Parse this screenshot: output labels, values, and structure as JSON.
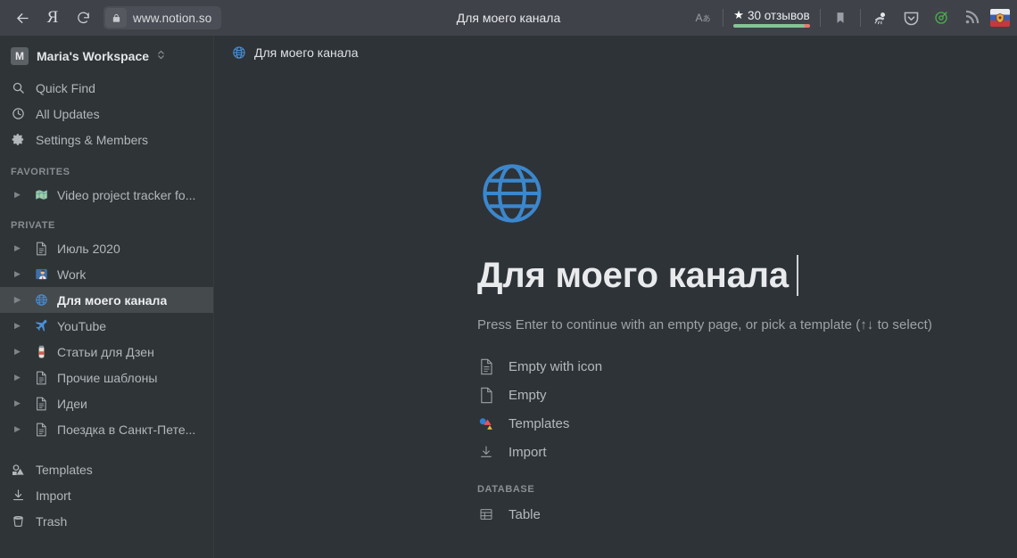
{
  "browser": {
    "back_label": "Back",
    "yandex_label": "Я",
    "reload_label": "Reload",
    "url": "www.notion.so",
    "lock_icon": "lock-icon",
    "window_title": "Для моего канала",
    "toolbar": {
      "translate_label": "A",
      "translate_sub": "あ",
      "reviews_star": "★",
      "reviews_text": "30 отзывов",
      "reviews_fill_color": "#86c496",
      "reviews_track_color": "#e8796f",
      "bookmark_icon": "bookmark-icon",
      "adblock_icon": "adblock-icon",
      "pocket_icon": "pocket-icon",
      "green_shield_icon": "green-circle-icon",
      "rss_icon": "rss-icon",
      "flag_icon": "russia-emblem-icon"
    }
  },
  "sidebar": {
    "workspace": {
      "avatar_letter": "M",
      "name": "Maria's Workspace",
      "caret": "⌃⌄"
    },
    "nav": [
      {
        "label": "Quick Find",
        "icon": "search-icon"
      },
      {
        "label": "All Updates",
        "icon": "clock-icon"
      },
      {
        "label": "Settings & Members",
        "icon": "gear-icon"
      }
    ],
    "favorites_label": "FAVORITES",
    "favorites": [
      {
        "label": "Video project tracker fo...",
        "emoji": "🗺",
        "selected": false
      }
    ],
    "private_label": "PRIVATE",
    "private": [
      {
        "label": "Июль 2020",
        "emoji": "doc",
        "selected": false
      },
      {
        "label": "Work",
        "emoji": "👨‍💼",
        "selected": false
      },
      {
        "label": "Для моего канала",
        "emoji": "globe",
        "selected": true
      },
      {
        "label": "YouTube",
        "emoji": "✈",
        "selected": false
      },
      {
        "label": "Статьи для Дзен",
        "emoji": "🏺",
        "selected": false
      },
      {
        "label": "Прочие шаблоны",
        "emoji": "doc",
        "selected": false
      },
      {
        "label": "Идеи",
        "emoji": "doc",
        "selected": false
      },
      {
        "label": "Поездка в Санкт-Пете...",
        "emoji": "doc",
        "selected": false
      }
    ],
    "bottom": [
      {
        "label": "Templates",
        "icon": "templates-icon"
      },
      {
        "label": "Import",
        "icon": "import-icon"
      },
      {
        "label": "Trash",
        "icon": "trash-icon"
      }
    ]
  },
  "main": {
    "breadcrumb": {
      "label": "Для моего канала",
      "icon": "globe-icon"
    },
    "page_icon": "globe-icon",
    "page_title": "Для моего канала",
    "hint": "Press Enter to continue with an empty page, or pick a template (↑↓ to select)",
    "templates": [
      {
        "label": "Empty with icon",
        "icon": "document-lines-icon"
      },
      {
        "label": "Empty",
        "icon": "document-blank-icon"
      },
      {
        "label": "Templates",
        "icon": "templates-color-icon"
      },
      {
        "label": "Import",
        "icon": "import-icon"
      }
    ],
    "database_label": "DATABASE",
    "database": [
      {
        "label": "Table",
        "icon": "table-icon"
      }
    ]
  }
}
